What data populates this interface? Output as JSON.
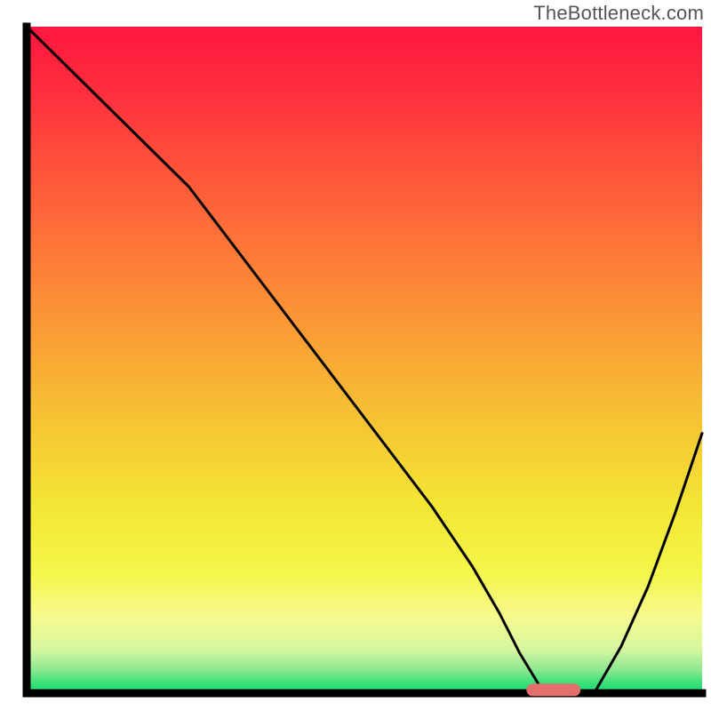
{
  "watermark": "TheBottleneck.com",
  "colors": {
    "axis": "#000000",
    "curve": "#000000",
    "marker_fill": "#e36f6a",
    "gradient_stops": [
      {
        "offset": 0.0,
        "color": "#ff163f"
      },
      {
        "offset": 0.1,
        "color": "#ff2f3e"
      },
      {
        "offset": 0.22,
        "color": "#ff553b"
      },
      {
        "offset": 0.35,
        "color": "#fd7c38"
      },
      {
        "offset": 0.48,
        "color": "#f9a335"
      },
      {
        "offset": 0.6,
        "color": "#f6c633"
      },
      {
        "offset": 0.72,
        "color": "#f4e634"
      },
      {
        "offset": 0.82,
        "color": "#f4f64a"
      },
      {
        "offset": 0.885,
        "color": "#f6fa8e"
      },
      {
        "offset": 0.935,
        "color": "#d6f6a0"
      },
      {
        "offset": 0.965,
        "color": "#8ce890"
      },
      {
        "offset": 0.985,
        "color": "#3adf78"
      },
      {
        "offset": 1.0,
        "color": "#19d96e"
      }
    ]
  },
  "chart_data": {
    "type": "line",
    "title": "",
    "xlabel": "",
    "ylabel": "",
    "xlim": [
      0,
      100
    ],
    "ylim": [
      0,
      100
    ],
    "grid": false,
    "legend": false,
    "x": [
      0,
      6,
      12,
      18,
      24,
      30,
      36,
      42,
      48,
      54,
      60,
      66,
      70,
      73,
      76,
      80,
      84,
      88,
      92,
      96,
      100
    ],
    "values": [
      100,
      94,
      88,
      82,
      76,
      68,
      60,
      52,
      44,
      36,
      28,
      19,
      12,
      6,
      1,
      0,
      0,
      7,
      16,
      27,
      39
    ],
    "marker": {
      "x_center": 78,
      "x_halfwidth": 4,
      "y": 0.5
    }
  }
}
